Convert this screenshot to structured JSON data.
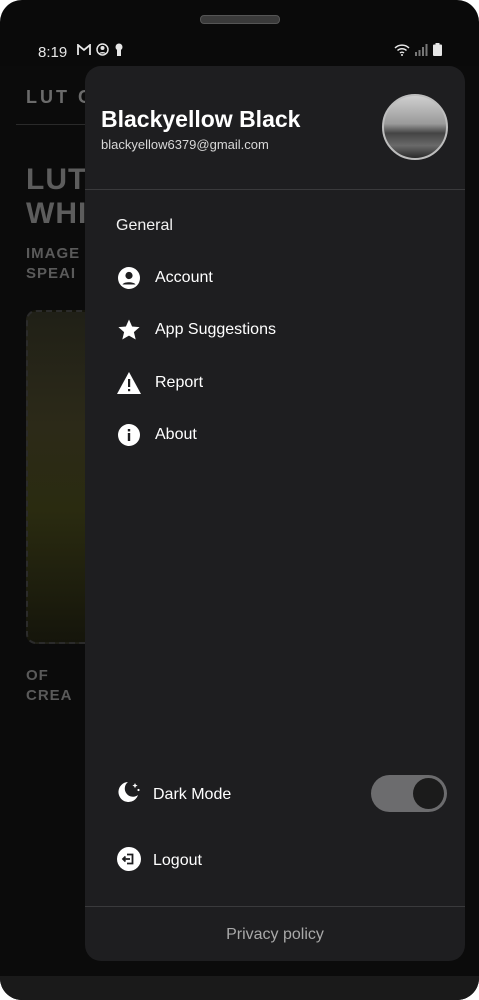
{
  "status_bar": {
    "time": "8:19",
    "left_icons": [
      "gmail-icon",
      "account-circle-icon",
      "keyhole-icon"
    ],
    "right_icons": [
      "wifi-icon",
      "signal-icon",
      "battery-icon"
    ]
  },
  "background_app": {
    "header": "LUT G",
    "title_line1": "LUTS",
    "title_line2": "WHI",
    "subtitle_line1": "IMAGE",
    "subtitle_line2": "SPEAI",
    "bottom_line1": "OF",
    "bottom_line2": "CREA"
  },
  "drawer": {
    "user": {
      "name": "Blackyellow Black",
      "email": "blackyellow6379@gmail.com"
    },
    "section_title": "General",
    "menu": [
      {
        "label": "Account",
        "icon": "account-icon"
      },
      {
        "label": "App Suggestions",
        "icon": "star-icon"
      },
      {
        "label": "Report",
        "icon": "warning-icon"
      },
      {
        "label": "About",
        "icon": "info-icon"
      }
    ],
    "dark_mode": {
      "label": "Dark Mode",
      "icon": "moon-stars-icon",
      "enabled": true
    },
    "logout": {
      "label": "Logout",
      "icon": "logout-icon"
    },
    "privacy_policy": "Privacy policy"
  },
  "colors": {
    "drawer_bg": "#1e1e20",
    "screen_bg": "#0b0b0b",
    "text_primary": "#ffffff",
    "toggle_track": "#6c6c6e"
  }
}
